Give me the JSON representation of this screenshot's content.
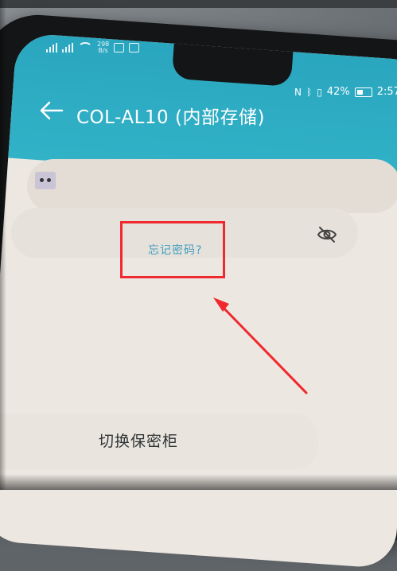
{
  "app_bar": {
    "title": "COL-AL10 (内部存储)",
    "back_icon": "arrow-left-icon"
  },
  "status_bar": {
    "net_speed_value": "298",
    "net_speed_unit": "B/s",
    "battery_percent": "42%",
    "time": "2:57"
  },
  "password_field": {
    "visibility_icon": "eye-off-icon"
  },
  "forgot_password": {
    "label": "忘记密码?"
  },
  "switch_safe": {
    "label": "切换保密柜"
  },
  "colors": {
    "app_bar": "#31b2c7",
    "link": "#3f9fc1",
    "annotation": "#f0292e",
    "screen_bg": "#ece7e1"
  }
}
